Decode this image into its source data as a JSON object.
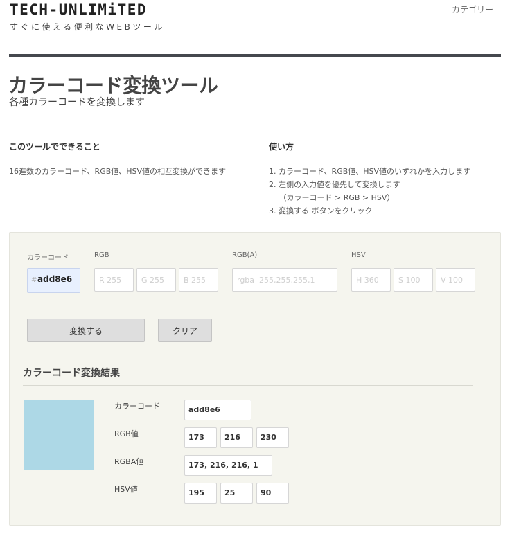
{
  "header": {
    "logo": "TECH-UNLIMiTED",
    "tagline": "すぐに使える便利なWEBツール",
    "nav_category": "カテゴリー"
  },
  "page": {
    "title": "カラーコード変換ツール",
    "subtitle": "各種カラーコードを変換します"
  },
  "about": {
    "heading": "このツールでできること",
    "text": "16進数のカラーコード、RGB値、HSV値の相互変換ができます"
  },
  "howto": {
    "heading": "使い方",
    "steps": [
      "1. カラーコード、RGB値、HSV値のいずれかを入力します",
      "2. 左側の入力値を優先して変換します",
      "　 （カラーコード > RGB > HSV）",
      "3. 変換する ボタンをクリック"
    ]
  },
  "form": {
    "hex_label": "カラーコード",
    "hex_prefix": "#",
    "hex_value": "add8e6",
    "rgb_label": "RGB",
    "r_placeholder": "R 255",
    "g_placeholder": "G 255",
    "b_placeholder": "B 255",
    "rgba_label": "RGB(A)",
    "rgba_placeholder": "rgba  255,255,255,1",
    "hsv_label": "HSV",
    "h_placeholder": "H 360",
    "s_placeholder": "S 100",
    "v_placeholder": "V 100",
    "convert_label": "変換する",
    "clear_label": "クリア"
  },
  "result": {
    "heading": "カラーコード変換結果",
    "swatch_color": "#add8e6",
    "hex_label": "カラーコード",
    "hex_value": "add8e6",
    "rgb_label": "RGB値",
    "rgb_r": "173",
    "rgb_g": "216",
    "rgb_b": "230",
    "rgba_label": "RGBA値",
    "rgba_value": "173, 216, 216, 1",
    "hsv_label": "HSV値",
    "hsv_h": "195",
    "hsv_s": "25",
    "hsv_v": "90"
  }
}
